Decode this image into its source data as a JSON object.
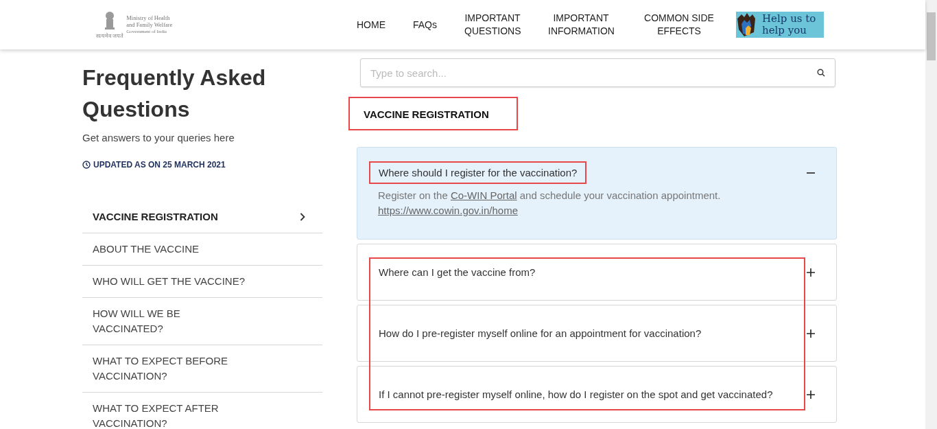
{
  "header": {
    "logo": {
      "lines": [
        "Ministry of Health",
        "and Family Welfare",
        "Government of India"
      ],
      "motto": "सत्यमेव जयते"
    },
    "nav": [
      {
        "label": "HOME"
      },
      {
        "label": "FAQs"
      },
      {
        "label": "IMPORTANT QUESTIONS"
      },
      {
        "label": "IMPORTANT INFORMATION"
      },
      {
        "label": "COMMON SIDE EFFECTS"
      }
    ],
    "banner": {
      "lines": [
        "Help us to",
        "help you"
      ]
    }
  },
  "intro": {
    "title": "Frequently Asked Questions",
    "subtitle": "Get answers to your queries here",
    "updated": "UPDATED AS ON 25 MARCH 2021"
  },
  "sidebar": {
    "items": [
      {
        "label": "VACCINE REGISTRATION",
        "selected": true
      },
      {
        "label": "ABOUT THE VACCINE",
        "selected": false
      },
      {
        "label": "WHO WILL GET THE VACCINE?",
        "selected": false
      },
      {
        "label": "HOW WILL WE BE VACCINATED?",
        "selected": false
      },
      {
        "label": "WHAT TO EXPECT BEFORE VACCINATION?",
        "selected": false
      },
      {
        "label": "WHAT TO EXPECT AFTER VACCINATION?",
        "selected": false
      }
    ]
  },
  "search": {
    "placeholder": "Type to search..."
  },
  "section": {
    "title": "VACCINE REGISTRATION",
    "highlighted": true
  },
  "questions": [
    {
      "question": "Where should I register for the vaccination?",
      "expanded": true,
      "highlighted": true,
      "in_group_highlight": false,
      "answer": {
        "before": "Register on the ",
        "link": "Co-WIN Portal",
        "after": " and schedule your vaccination appointment.",
        "url": "https://www.cowin.gov.in/home"
      }
    },
    {
      "question": "Where can I get the vaccine from?",
      "expanded": false,
      "highlighted": false,
      "in_group_highlight": true
    },
    {
      "question": "How do I pre-register myself online for an appointment for vaccination?",
      "expanded": false,
      "highlighted": false,
      "in_group_highlight": true
    },
    {
      "question": "If I cannot pre-register myself online, how do I register on the spot and get vaccinated?",
      "expanded": false,
      "highlighted": false,
      "in_group_highlight": true
    }
  ]
}
